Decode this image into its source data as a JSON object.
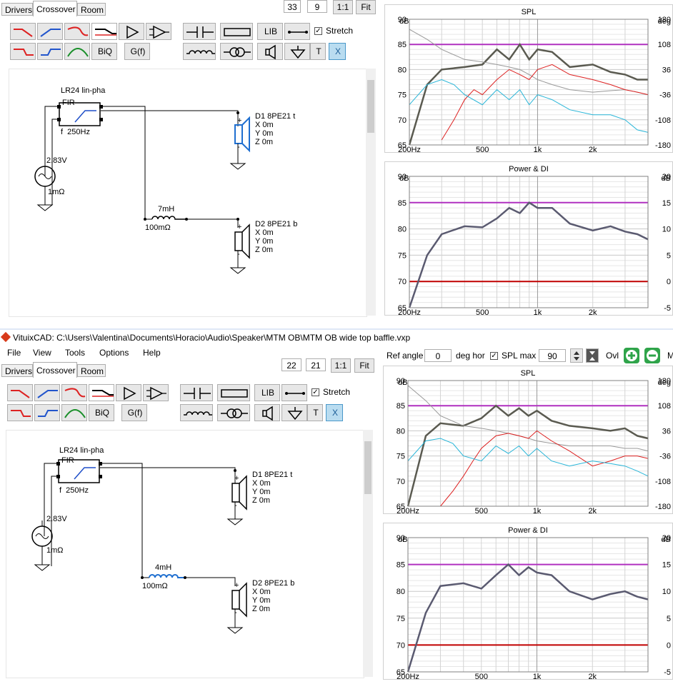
{
  "window": {
    "title": "VituixCAD: C:\\Users\\Valentina\\Documents\\Horacio\\Audio\\Speaker\\MTM OB\\MTM OB wide top baffle.vxp",
    "menu": [
      "File",
      "View",
      "Tools",
      "Options",
      "Help"
    ]
  },
  "tabs": [
    "Drivers",
    "Crossover",
    "Room"
  ],
  "toolbar": {
    "lib": "LIB",
    "stretch": "Stretch",
    "biq": "BiQ",
    "gf": "G(f)",
    "t": "T",
    "x": "X",
    "one_to_one": "1:1",
    "fit": "Fit"
  },
  "ref": {
    "ref_angle_label": "Ref angle",
    "ref_angle": "0",
    "deg_hor": "deg hor",
    "spl_max_label": "SPL max",
    "spl_max": "90",
    "ovl": "Ovl",
    "m": "M"
  },
  "panels": [
    {
      "zoom_a": "33",
      "zoom_b": "9",
      "schematic": {
        "filter_title": "LR24 lin-pha",
        "fir": "FIR",
        "freq": "f  250Hz",
        "source_v": "2.83V",
        "source_r": "1mΩ",
        "d1": {
          "name": "D1 8PE21 t",
          "x": "X 0m",
          "y": "Y 0m",
          "z": "Z 0m"
        },
        "d2": {
          "name": "D2 8PE21 b",
          "x": "X 0m",
          "y": "Y 0m",
          "z": "Z 0m"
        },
        "inductor": "7mH",
        "inductor_r": "100mΩ"
      },
      "spl": {
        "title": "SPL",
        "ylabel_left": "dB",
        "ylabel_right": "deg",
        "yticks_left": [
          "90",
          "85",
          "80",
          "75",
          "70",
          "65"
        ],
        "yticks_right": [
          "180",
          "108",
          "36",
          "-36",
          "-108",
          "-180"
        ],
        "xticks": [
          "200Hz",
          "500",
          "1k",
          "2k"
        ]
      },
      "power": {
        "title": "Power & DI",
        "ylabel_left": "dB",
        "ylabel_right": "dB",
        "yticks_left": [
          "90",
          "85",
          "80",
          "75",
          "70",
          "65"
        ],
        "yticks_right": [
          "20",
          "15",
          "10",
          "5",
          "0",
          "-5"
        ],
        "xticks": [
          "200Hz",
          "500",
          "1k",
          "2k"
        ]
      }
    },
    {
      "zoom_a": "22",
      "zoom_b": "21",
      "schematic": {
        "filter_title": "LR24 lin-pha",
        "fir": "FIR",
        "freq": "f  250Hz",
        "source_v": "2.83V",
        "source_r": "1mΩ",
        "d1": {
          "name": "D1 8PE21 t",
          "x": "X 0m",
          "y": "Y 0m",
          "z": "Z 0m"
        },
        "d2": {
          "name": "D2 8PE21 b",
          "x": "X 0m",
          "y": "Y 0m",
          "z": "Z 0m"
        },
        "inductor": "4mH",
        "inductor_r": "100mΩ"
      },
      "spl": {
        "title": "SPL",
        "ylabel_left": "dB",
        "ylabel_right": "deg",
        "yticks_left": [
          "90",
          "85",
          "80",
          "75",
          "70",
          "65"
        ],
        "yticks_right": [
          "180",
          "108",
          "36",
          "-36",
          "-108",
          "-180"
        ],
        "xticks": [
          "200Hz",
          "500",
          "1k",
          "2k"
        ]
      },
      "power": {
        "title": "Power & DI",
        "ylabel_left": "dB",
        "ylabel_right": "dB",
        "yticks_left": [
          "90",
          "85",
          "80",
          "75",
          "70",
          "65"
        ],
        "yticks_right": [
          "20",
          "15",
          "10",
          "5",
          "0",
          "-5"
        ],
        "xticks": [
          "200Hz",
          "500",
          "1k",
          "2k"
        ]
      }
    }
  ],
  "chart_data": [
    {
      "name": "SPL (top)",
      "type": "line",
      "x_scale": "log",
      "xlim": [
        200,
        4000
      ],
      "ylim": [
        65,
        90
      ],
      "y2lim": [
        -180,
        180
      ],
      "series": [
        {
          "color": "#5a5a50",
          "x": [
            200,
            250,
            300,
            400,
            500,
            600,
            700,
            800,
            900,
            1000,
            1200,
            1500,
            2000,
            2500,
            3000,
            3500,
            4000
          ],
          "y": [
            65,
            77,
            80,
            80.5,
            81,
            84,
            82,
            85,
            82,
            84,
            83.5,
            80.5,
            81,
            79.5,
            79,
            78,
            78
          ]
        },
        {
          "color": "#999999",
          "x": [
            200,
            250,
            300,
            400,
            500,
            600,
            700,
            800,
            900,
            1000,
            1200,
            1500,
            2000,
            2500,
            3000,
            3500,
            4000
          ],
          "y": [
            88,
            86,
            84,
            82,
            81.5,
            81,
            80.5,
            80,
            79,
            78,
            77,
            76,
            75.5,
            75.8,
            76,
            75.5,
            75
          ]
        },
        {
          "color": "#dd2020",
          "x": [
            300,
            350,
            400,
            450,
            500,
            600,
            700,
            800,
            900,
            1000,
            1200,
            1500,
            2000,
            2500,
            3000,
            3500,
            4000
          ],
          "y": [
            66,
            70,
            74,
            76,
            75,
            78,
            80,
            79,
            78,
            80,
            81,
            79,
            78,
            77,
            76,
            75.5,
            75
          ]
        },
        {
          "color": "#27b5d8",
          "x": [
            200,
            250,
            300,
            350,
            400,
            500,
            600,
            700,
            800,
            900,
            1000,
            1200,
            1500,
            2000,
            2500,
            3000,
            3500,
            4000
          ],
          "y": [
            73,
            77,
            78,
            77,
            75,
            73,
            76,
            74,
            76,
            73,
            75,
            74,
            72,
            71,
            71,
            70,
            68,
            67.5
          ]
        }
      ],
      "lines": [
        {
          "y": 85,
          "color": "#b030c0"
        }
      ]
    },
    {
      "name": "Power & DI (top)",
      "type": "line",
      "x_scale": "log",
      "xlim": [
        200,
        4000
      ],
      "ylim": [
        65,
        90
      ],
      "series": [
        {
          "color": "#5a5a70",
          "x": [
            200,
            250,
            300,
            400,
            500,
            600,
            700,
            800,
            900,
            1000,
            1200,
            1500,
            2000,
            2500,
            3000,
            3500,
            4000
          ],
          "y": [
            65,
            75,
            79,
            80.5,
            80.3,
            82,
            84,
            83,
            85,
            84,
            84,
            81,
            79.7,
            80.5,
            79.5,
            79,
            78
          ]
        }
      ],
      "lines": [
        {
          "y": 85,
          "color": "#b030c0"
        },
        {
          "y": 70,
          "color": "#c00000"
        }
      ]
    },
    {
      "name": "SPL (bottom)",
      "type": "line",
      "x_scale": "log",
      "xlim": [
        200,
        4000
      ],
      "ylim": [
        65,
        90
      ],
      "y2lim": [
        -180,
        180
      ],
      "series": [
        {
          "color": "#5a5a50",
          "x": [
            200,
            250,
            300,
            400,
            500,
            600,
            700,
            800,
            900,
            1000,
            1200,
            1500,
            2000,
            2500,
            3000,
            3500,
            4000
          ],
          "y": [
            65,
            79,
            81.5,
            81,
            82.5,
            85,
            83,
            84.5,
            83,
            84,
            82,
            81,
            80.5,
            80,
            80.5,
            79,
            78.5
          ]
        },
        {
          "color": "#999999",
          "x": [
            200,
            250,
            300,
            400,
            500,
            600,
            700,
            800,
            900,
            1000,
            1200,
            1500,
            2000,
            2500,
            3000,
            3500,
            4000
          ],
          "y": [
            89,
            86,
            83,
            81,
            80.5,
            80,
            79.5,
            79,
            78.5,
            78,
            77.5,
            77,
            77,
            77,
            76.5,
            76.5,
            76
          ]
        },
        {
          "color": "#dd2020",
          "x": [
            300,
            350,
            400,
            450,
            500,
            600,
            700,
            800,
            900,
            1000,
            1200,
            1500,
            2000,
            2500,
            3000,
            3500,
            4000
          ],
          "y": [
            65,
            68,
            71,
            74,
            76.5,
            79,
            79.5,
            79,
            78.5,
            80,
            78,
            76,
            73,
            74,
            75,
            75,
            74.5
          ]
        },
        {
          "color": "#27b5d8",
          "x": [
            200,
            250,
            300,
            350,
            400,
            500,
            600,
            700,
            800,
            900,
            1000,
            1200,
            1500,
            2000,
            2500,
            3000,
            3500,
            4000
          ],
          "y": [
            74,
            78,
            78.5,
            77.5,
            75,
            74,
            77,
            75.5,
            77,
            75,
            76.5,
            74,
            73,
            74,
            73.5,
            73,
            72,
            71
          ]
        }
      ],
      "lines": [
        {
          "y": 85,
          "color": "#b030c0"
        }
      ]
    },
    {
      "name": "Power & DI (bottom)",
      "type": "line",
      "x_scale": "log",
      "xlim": [
        200,
        4000
      ],
      "ylim": [
        65,
        90
      ],
      "series": [
        {
          "color": "#5a5a70",
          "x": [
            200,
            250,
            300,
            400,
            500,
            600,
            700,
            800,
            900,
            1000,
            1200,
            1500,
            2000,
            2500,
            3000,
            3500,
            4000
          ],
          "y": [
            65,
            76,
            81,
            81.5,
            80.5,
            83,
            85,
            83,
            84.5,
            83.5,
            83,
            80,
            78.5,
            79.5,
            80,
            79,
            78.5
          ]
        }
      ],
      "lines": [
        {
          "y": 85,
          "color": "#b030c0"
        },
        {
          "y": 70,
          "color": "#c00000"
        }
      ]
    }
  ],
  "colors": {
    "accent": "#3366cc",
    "magenta": "#b030c0",
    "darkred": "#c00000",
    "selected": "#1f6fd0"
  }
}
